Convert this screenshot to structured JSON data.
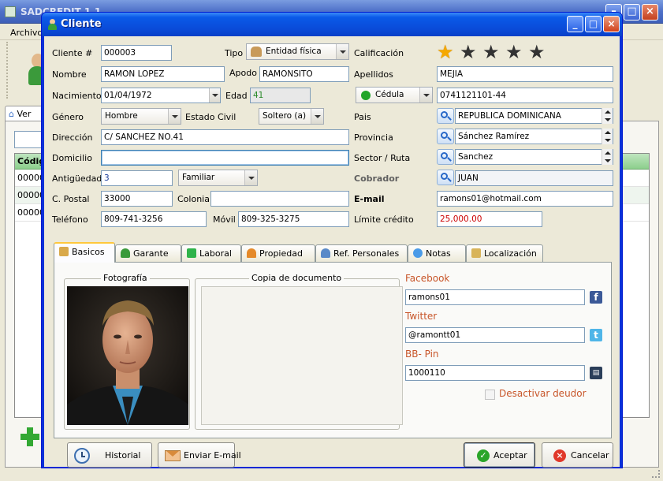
{
  "background_app": {
    "title": "SADCREDIT 1.1",
    "menu_archivos": "Archivos",
    "tab_label": "Ver",
    "grid_header": "Códig",
    "rows": [
      "00000",
      "00000",
      "00000"
    ]
  },
  "dialog": {
    "title": "Cliente",
    "colors": {
      "title_bar": "#0A4BD8",
      "body": "#ECE9D8",
      "accent_tab": "#FFC83C",
      "social_label": "#C8562A"
    }
  },
  "form": {
    "cliente_label": "Cliente #",
    "cliente_value": "000003",
    "tipo_label": "Tipo",
    "tipo_value": "Entidad física",
    "calificacion_label": "Calificación",
    "calificacion_rating": 1,
    "calificacion_max": 5,
    "nombre_label": "Nombre",
    "nombre_value": "RAMON LOPEZ",
    "apodo_label": "Apodo",
    "apodo_value": "RAMONSITO",
    "apellidos_label": "Apellidos",
    "apellidos_value": "MEJIA",
    "nacimiento_label": "Nacimiento",
    "nacimiento_value": "01/04/1972",
    "edad_label": "Edad",
    "edad_value": "41",
    "id_type_value": "Cédula",
    "id_value": "0741121101-44",
    "genero_label": "Género",
    "genero_value": "Hombre",
    "estado_label": "Estado  Civil",
    "estado_value": "Soltero (a)",
    "pais_label": "Pais",
    "pais_value": "REPUBLICA DOMINICANA",
    "direccion_label": "Dirección",
    "direccion_value": "C/ SANCHEZ NO.41",
    "provincia_label": "Provincia",
    "provincia_value": "Sánchez Ramírez",
    "domicilio_label": "Domicilio",
    "domicilio_value": "",
    "sector_label": "Sector / Ruta",
    "sector_value": "Sanchez",
    "antiguedad_label": "Antigüedad",
    "antiguedad_value": "3",
    "antiguedad_unit": "Familiar",
    "cobrador_label": "Cobrador",
    "cobrador_value": "JUAN",
    "postal_label": "C. Postal",
    "postal_value": "33000",
    "colonia_label": "Colonia",
    "colonia_value": "",
    "email_label": "E-mail",
    "email_value": "ramons01@hotmail.com",
    "telefono_label": "Teléfono",
    "telefono_value": "809-741-3256",
    "movil_label": "Móvil",
    "movil_value": "809-325-3275",
    "limite_label": "Límite crédito",
    "limite_value": "25,000.00"
  },
  "tabs": [
    {
      "label": "Basicos",
      "icon": "basicos-icon"
    },
    {
      "label": "Garante",
      "icon": "garante-icon"
    },
    {
      "label": "Laboral",
      "icon": "laboral-icon"
    },
    {
      "label": "Propiedad",
      "icon": "propiedad-icon"
    },
    {
      "label": "Ref. Personales",
      "icon": "ref-personales-icon"
    },
    {
      "label": "Notas",
      "icon": "notas-icon"
    },
    {
      "label": "Localización",
      "icon": "localizacion-icon"
    }
  ],
  "basicos": {
    "foto_label": "Fotografía",
    "copia_label": "Copia de documento",
    "facebook_label": "Facebook",
    "facebook_value": "ramons01",
    "twitter_label": "Twitter",
    "twitter_value": "@ramontt01",
    "bb_label": "BB- Pin",
    "bb_value": "1000110",
    "desactivar_label": "Desactivar deudor"
  },
  "buttons": {
    "historial": "Historial",
    "enviar_email": "Enviar E-mail",
    "aceptar": "Aceptar",
    "cancelar": "Cancelar"
  }
}
